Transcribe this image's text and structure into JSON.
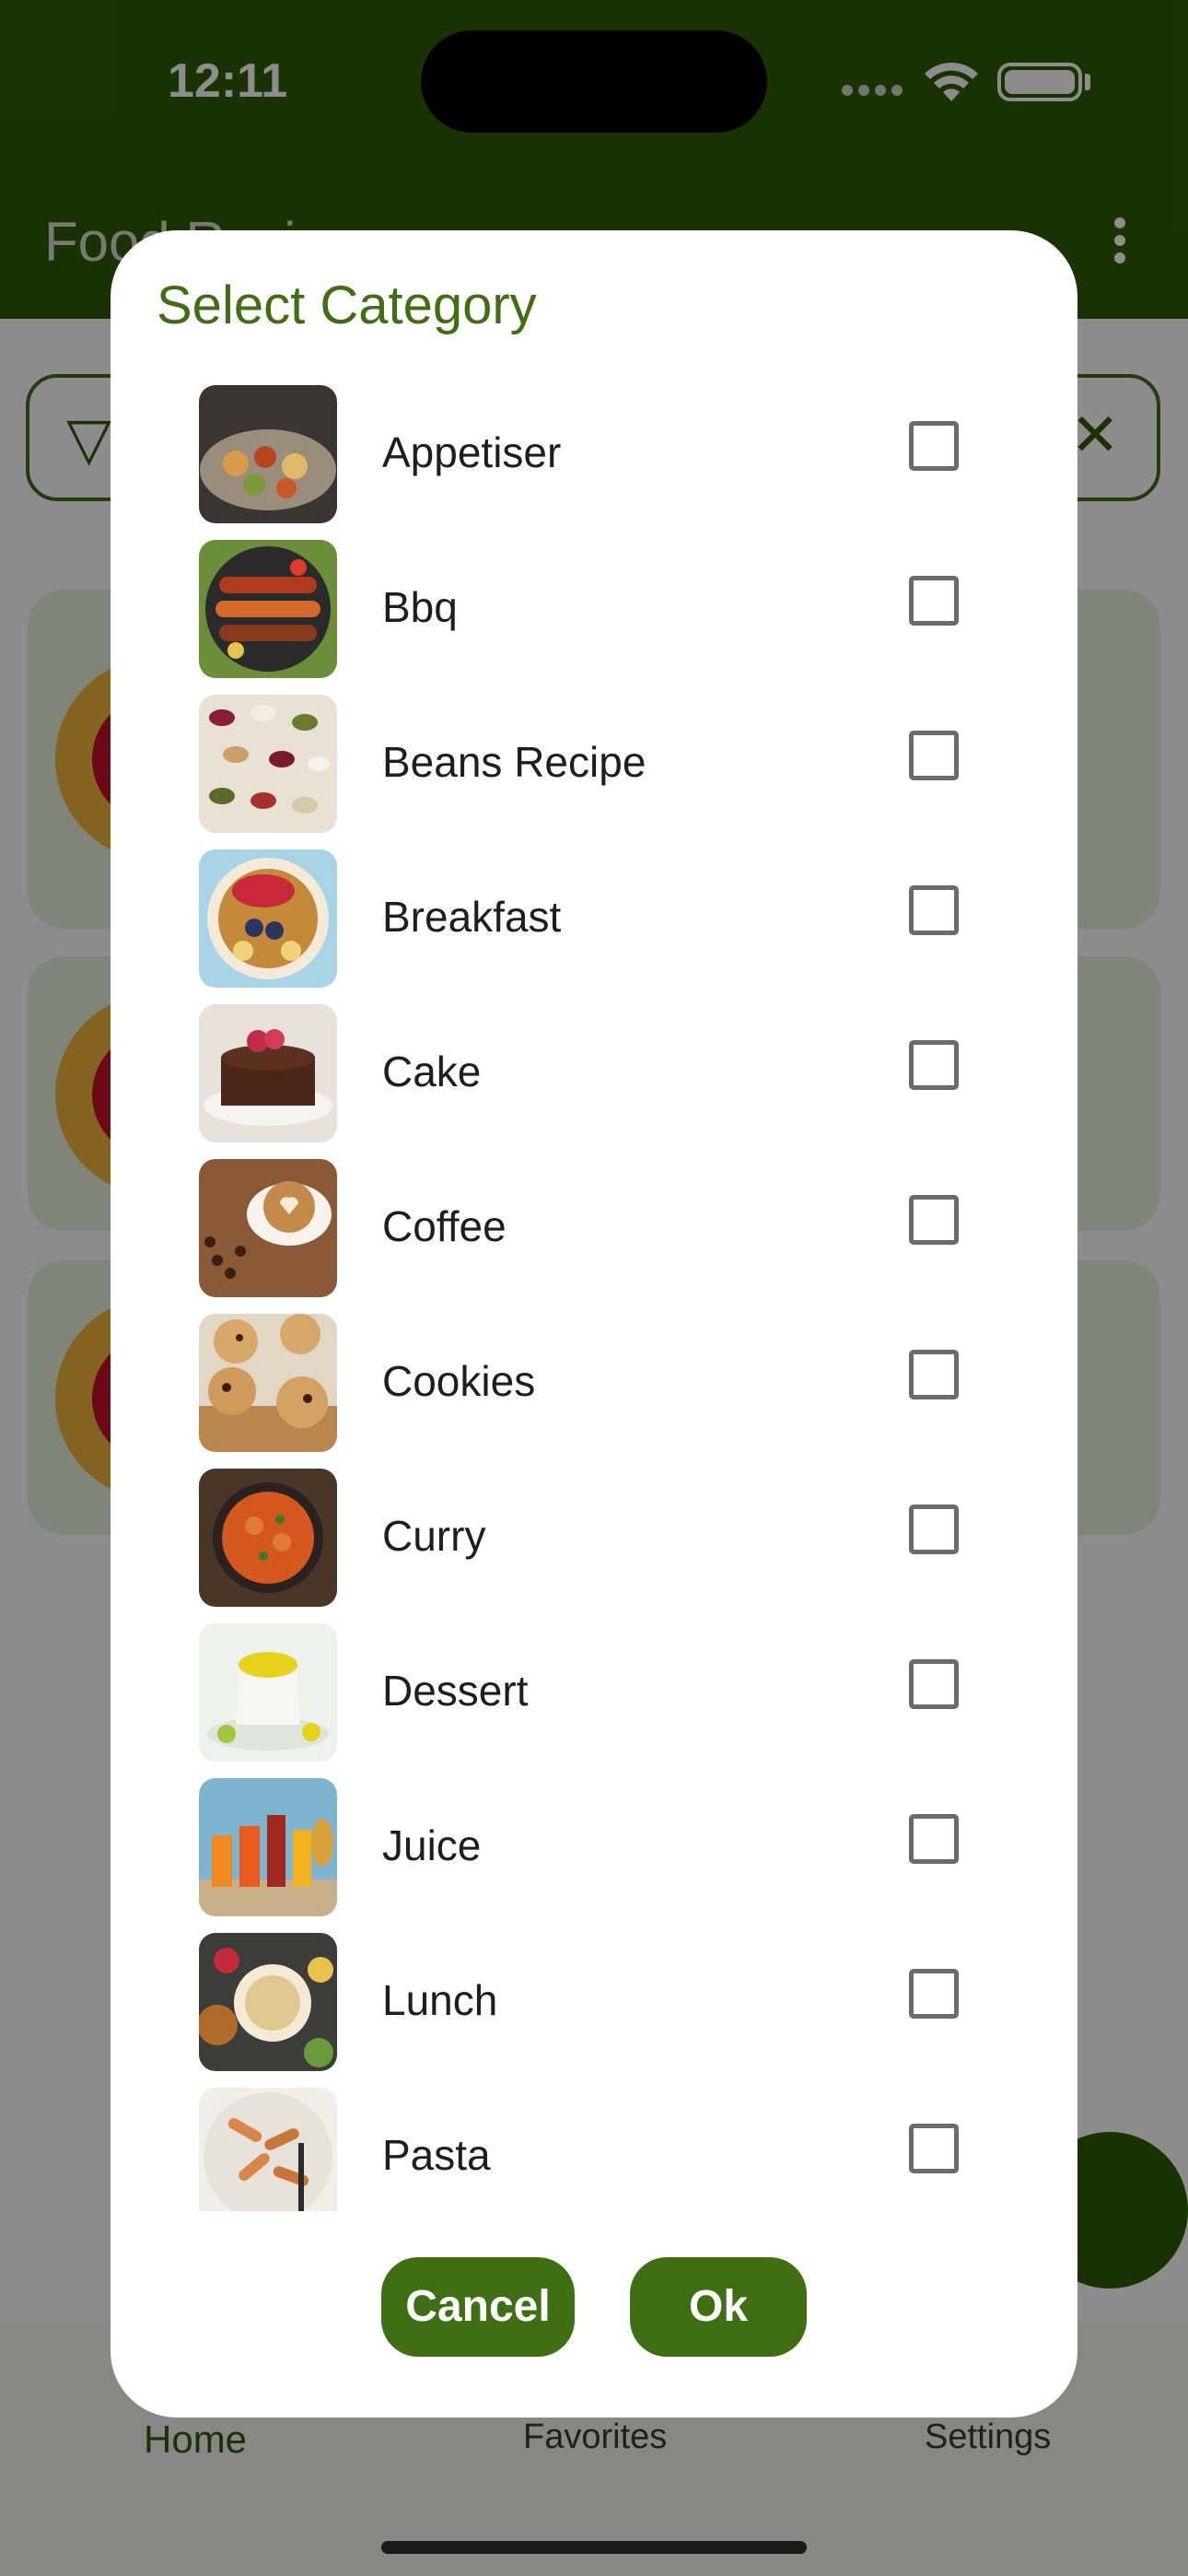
{
  "status_bar": {
    "time": "12:11"
  },
  "app_bar": {
    "title": "Food Recipes"
  },
  "bottom_nav": {
    "home": "Home",
    "favorites": "Favorites",
    "settings": "Settings"
  },
  "dialog": {
    "title": "Select Category",
    "categories": [
      {
        "label": "Appetiser",
        "checked": false
      },
      {
        "label": "Bbq",
        "checked": false
      },
      {
        "label": "Beans Recipe",
        "checked": false
      },
      {
        "label": "Breakfast",
        "checked": false
      },
      {
        "label": "Cake",
        "checked": false
      },
      {
        "label": "Coffee",
        "checked": false
      },
      {
        "label": "Cookies",
        "checked": false
      },
      {
        "label": "Curry",
        "checked": false
      },
      {
        "label": "Dessert",
        "checked": false
      },
      {
        "label": "Juice",
        "checked": false
      },
      {
        "label": "Lunch",
        "checked": false
      },
      {
        "label": "Pasta",
        "checked": false
      }
    ],
    "cancel_label": "Cancel",
    "ok_label": "Ok"
  },
  "colors": {
    "primary": "#2f5c05",
    "accent": "#3f6f12"
  }
}
